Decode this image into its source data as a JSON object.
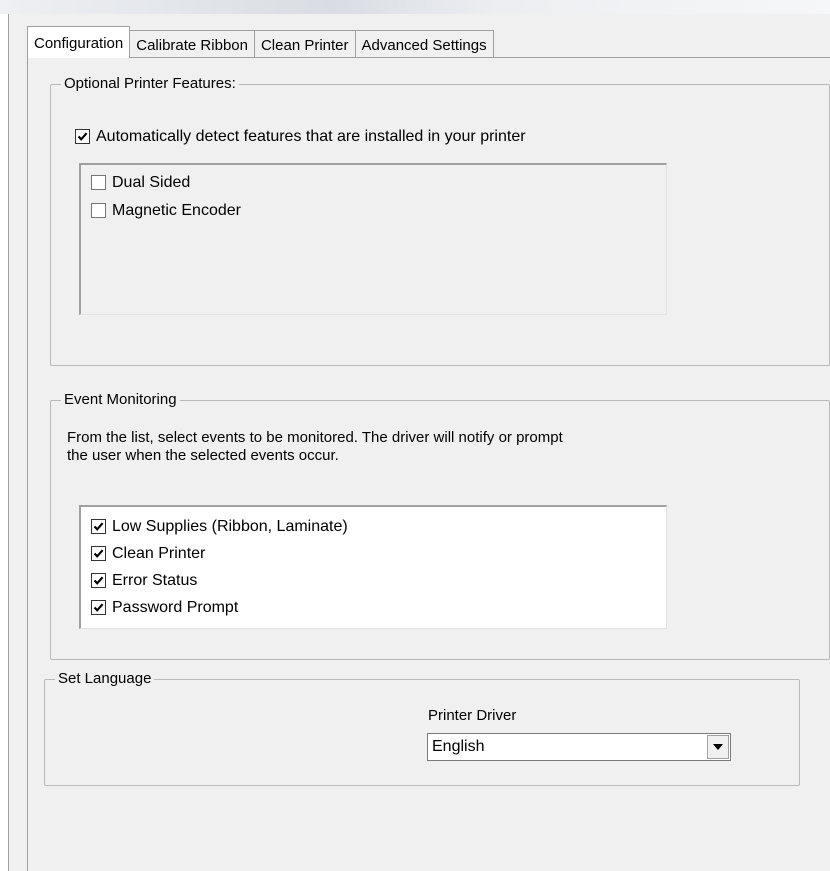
{
  "tabs": [
    {
      "label": "Configuration",
      "active": true
    },
    {
      "label": "Calibrate Ribbon",
      "active": false
    },
    {
      "label": "Clean Printer",
      "active": false
    },
    {
      "label": "Advanced Settings",
      "active": false
    }
  ],
  "optional_features": {
    "title": "Optional Printer Features:",
    "auto_detect": {
      "label": "Automatically detect features that are installed in your printer",
      "checked": true
    },
    "items": [
      {
        "label": "Dual Sided",
        "checked": false
      },
      {
        "label": "Magnetic Encoder",
        "checked": false
      }
    ]
  },
  "event_monitoring": {
    "title": "Event Monitoring",
    "description_line1": "From the list, select events to be monitored.  The driver will notify or prompt",
    "description_line2": "the user when the selected events occur.",
    "items": [
      {
        "label": "Low Supplies (Ribbon,  Laminate)",
        "checked": true
      },
      {
        "label": "Clean Printer",
        "checked": true
      },
      {
        "label": "Error Status",
        "checked": true
      },
      {
        "label": "Password Prompt",
        "checked": true
      }
    ]
  },
  "set_language": {
    "title": "Set Language",
    "driver_label": "Printer Driver",
    "selected": "English"
  }
}
